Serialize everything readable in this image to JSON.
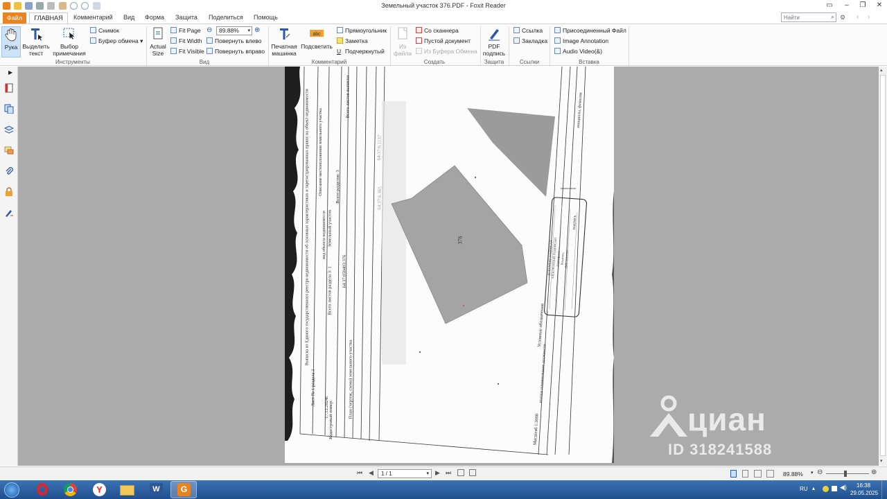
{
  "window": {
    "title": "Земельный участок 376.PDF - Foxit Reader"
  },
  "menu": {
    "file": "Файл",
    "home": "ГЛАВНАЯ",
    "comment": "Комментарий",
    "view": "Вид",
    "form": "Форма",
    "protect": "Защита",
    "share": "Поделиться",
    "help": "Помощь"
  },
  "search": {
    "placeholder": "Найти"
  },
  "ribbon": {
    "tools": {
      "label": "Инструменты",
      "hand": "Рука",
      "select_text": "Выделить текст",
      "select_annotation": "Выбор примечания",
      "snapshot": "Снимок",
      "clipboard": "Буфер обмена"
    },
    "view": {
      "label": "Вид",
      "actual_size": "Actual Size",
      "fit_page": "Fit Page",
      "fit_width": "Fit Width",
      "fit_visible": "Fit Visible",
      "zoom": "89.88%",
      "rotate_left": "Повернуть влево",
      "rotate_right": "Повернуть вправо"
    },
    "comment": {
      "label": "Комментарий",
      "typewriter": "Печатная машинка",
      "highlight": "Подсветить",
      "rectangle": "Прямоугольник",
      "note": "Заметка",
      "underline": "Подчеркнутый"
    },
    "create": {
      "label": "Создать",
      "from_file": "Из файла",
      "from_scanner": "Со сканнера",
      "blank": "Пустой документ",
      "from_clipboard": "Из Буфера Обмена"
    },
    "protect": {
      "label": "Защита",
      "pdf_sign": "PDF подпись"
    },
    "links": {
      "label": "Ссылки",
      "link": "Ссылка",
      "bookmark": "Закладка"
    },
    "insert": {
      "label": "Вставка",
      "attach_file": "Присоединенный Файл",
      "image_annotation": "Image Annotation",
      "audio_video": "Audio  Video(&)"
    }
  },
  "document": {
    "parcel_number": "376",
    "cadastral_number": "64:37:050403:376",
    "text_sheet": "Лист № 1 раздела 3",
    "text_total_sheets_section": "Всего листов раздела 3: 1",
    "text_total_sections": "Всего разделов: 3",
    "text_total_sheets": "Всего листов выписки",
    "text_cadastral_label": "Кадастровый номер:",
    "text_plan": "План (чертеж, схема) земельного участка",
    "text_scale": "Масштаб 1:3000",
    "text_symbols": "Условные обозначения",
    "text_position": "полное наименование должности",
    "text_signature": "подпись",
    "text_initials": "инициалы, фамилия",
    "text_extract": "Выписка из Единого государственного реестра недвижимости об основных характеристиках и зарегистрированных правах на объект недвижимости",
    "text_land": "Земельный участок",
    "text_object_kind": "вид объекта недвижимости",
    "text_location_desc": "Описание местоположения земельного участка",
    "text_neighbor_a": "64:37:6.365",
    "text_neighbor_b": "64:37:6.1137",
    "stamp_lines": [
      "ДОКУМЕНТ ПОДПИСАН",
      "ЭЛЕКТРОННОЙ ПОДПИСЬЮ",
      "Сертификат",
      "Владелец",
      "Действителен"
    ],
    "date_code": "17.12.2024г."
  },
  "watermark": {
    "brand": "циан",
    "id": "ID 318241588"
  },
  "bottom": {
    "page_indicator": "1 / 1",
    "zoom": "89.88%"
  },
  "taskbar": {
    "lang": "RU",
    "time": "16:38",
    "date": "29.05.2025"
  }
}
